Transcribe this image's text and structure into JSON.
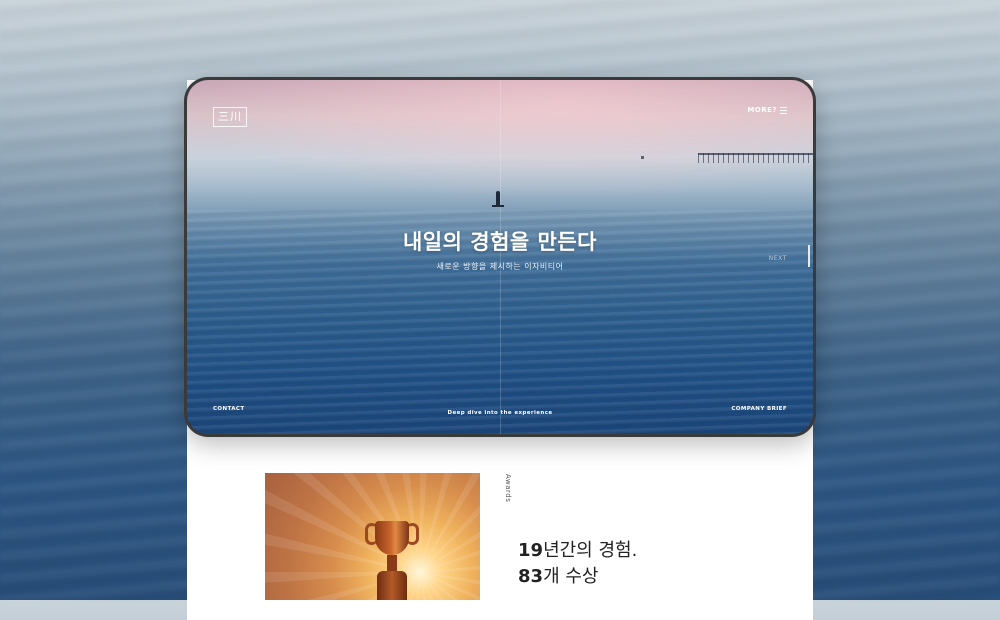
{
  "hero": {
    "logo_text": "三川",
    "more_label": "MORE?",
    "headline": "내일의 경험을 만든다",
    "subline": "새로운 방향을 제시하는 이자비티어",
    "next_label": "NEXT",
    "footer": {
      "contact": "CONTACT",
      "dive": "Deep dive into the experience",
      "brief": "COMPANY BRIEF"
    }
  },
  "awards": {
    "section_label": "Awards",
    "stat1_number": "19",
    "stat1_text": "년간의 경험.",
    "stat2_number": "83",
    "stat2_text": "개 수상"
  },
  "colors": {
    "ocean_deep": "#1f4f84",
    "sky_pink": "#d9c3c9",
    "device_frame": "#3a3a3a"
  }
}
